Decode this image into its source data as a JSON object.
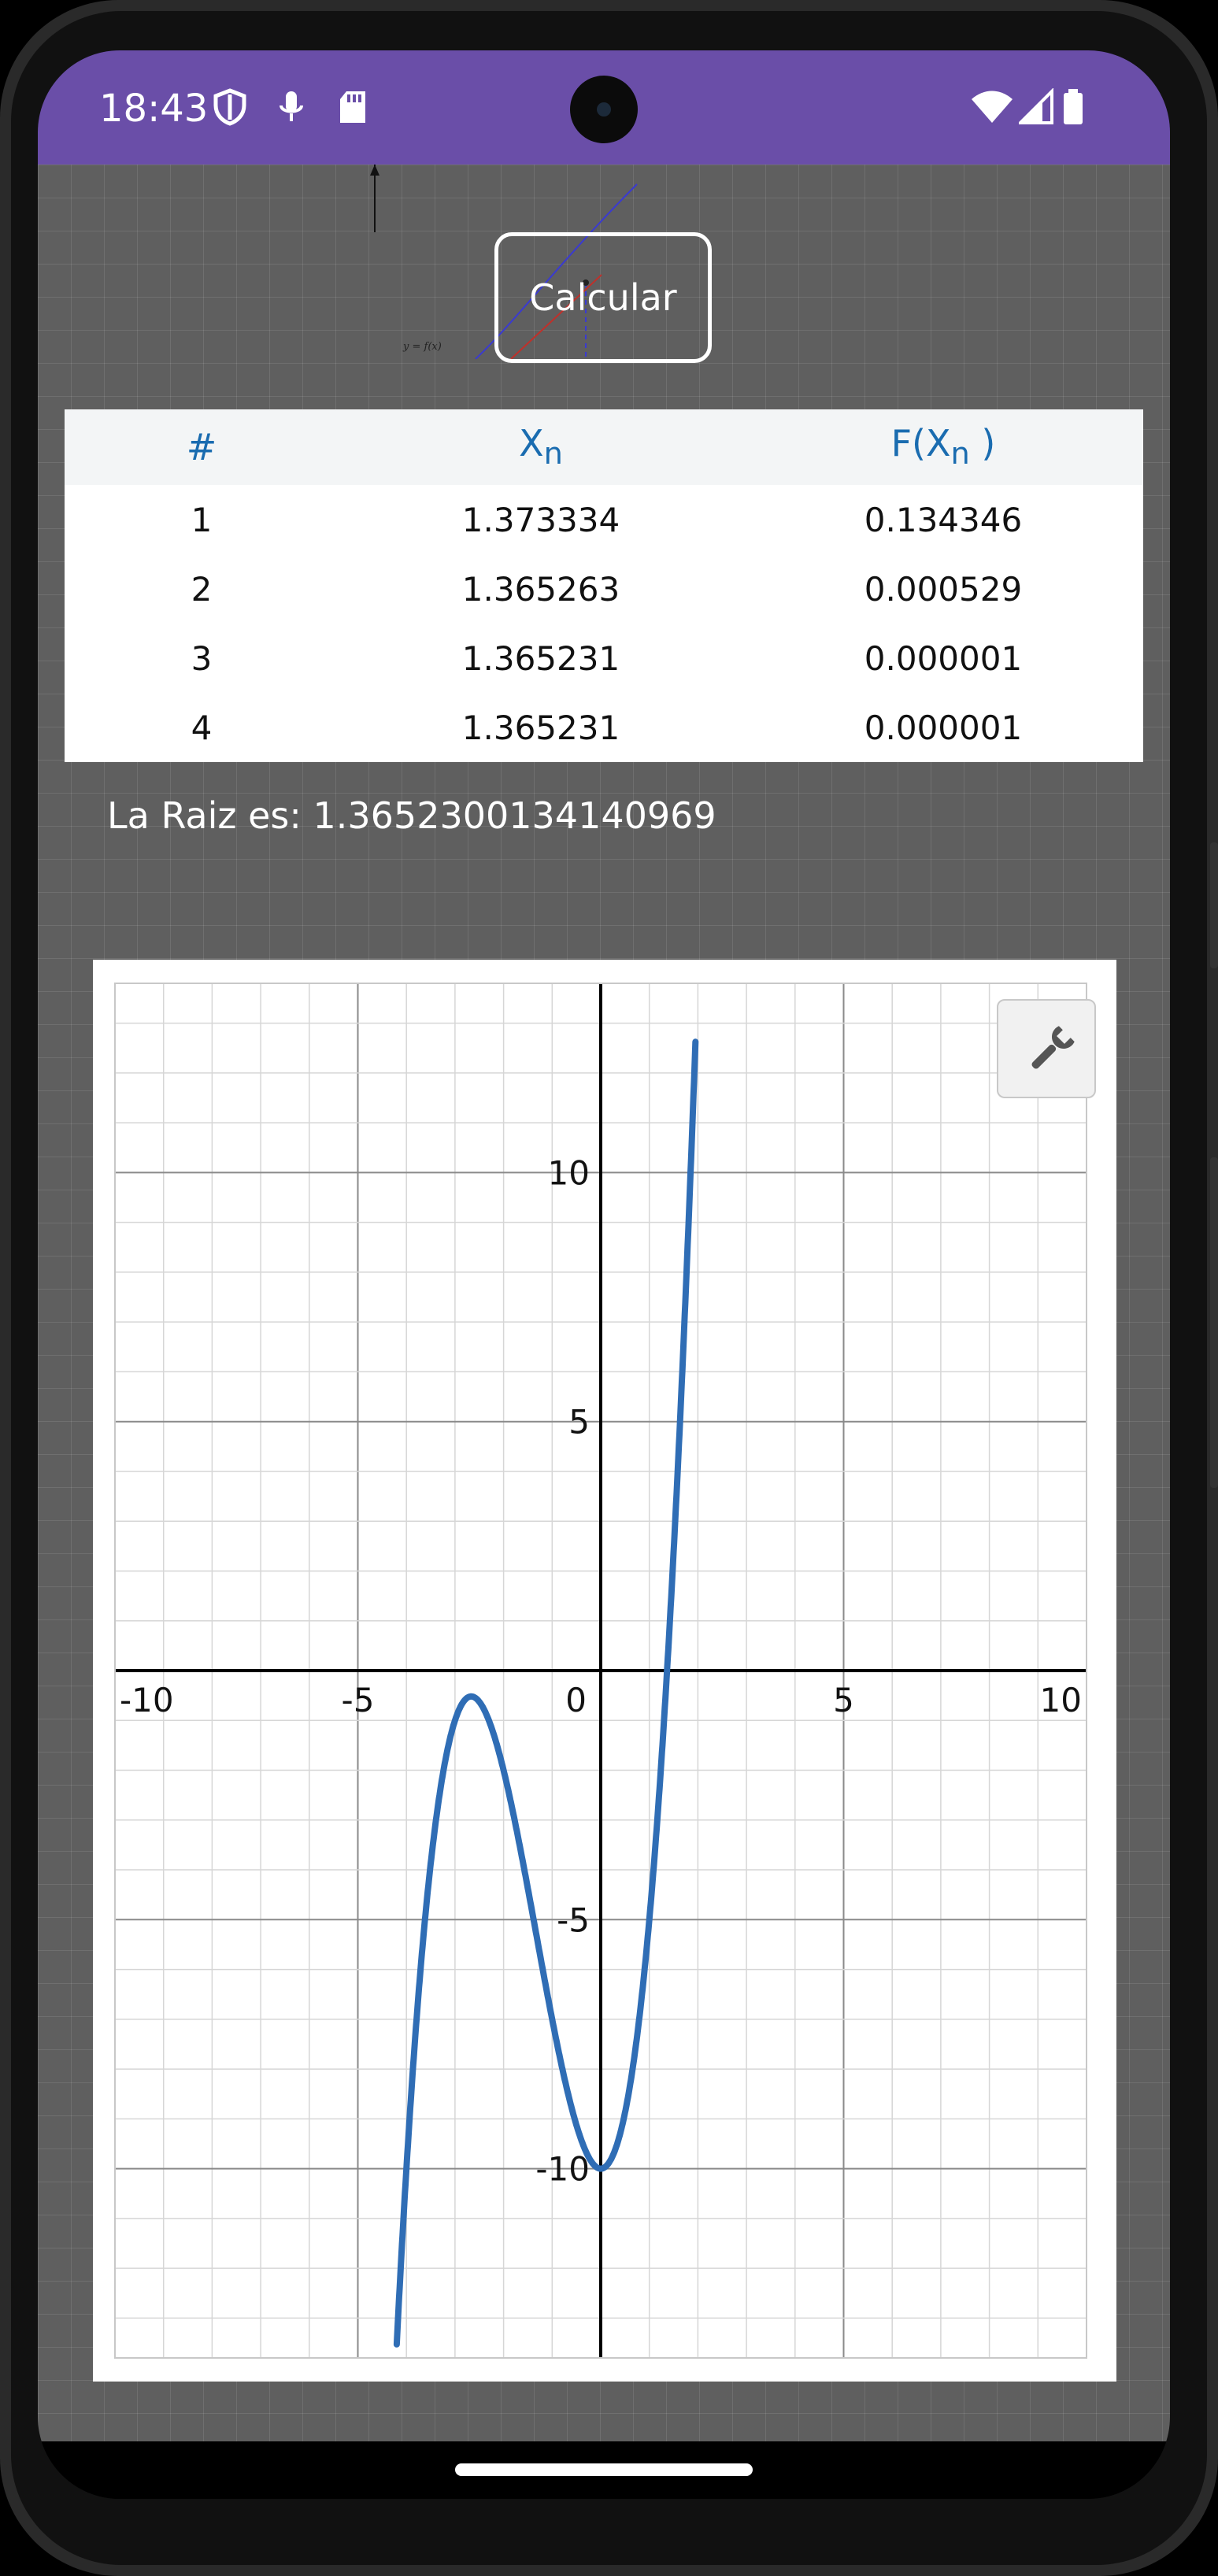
{
  "status_bar": {
    "time": "18:43",
    "left_icons": [
      "shield-icon",
      "mic-icon",
      "sd-card-icon"
    ],
    "right_icons": [
      "wifi-icon",
      "cell-signal-icon",
      "battery-icon"
    ],
    "color": "#6a4ea8"
  },
  "header": {
    "calculate_button": "Calcular",
    "illustration_label": "y = f(x)"
  },
  "table": {
    "headers": {
      "index": "#",
      "xn_main": "X",
      "xn_sub": "n",
      "fxn_main": "F(X",
      "fxn_sub": "n",
      "fxn_close": " )"
    },
    "rows": [
      {
        "n": "1",
        "xn": "1.373334",
        "fxn": "0.134346"
      },
      {
        "n": "2",
        "xn": "1.365263",
        "fxn": "0.000529"
      },
      {
        "n": "3",
        "xn": "1.365231",
        "fxn": "0.000001"
      },
      {
        "n": "4",
        "xn": "1.365231",
        "fxn": "0.000001"
      }
    ],
    "header_color": "#1a6cb0"
  },
  "result": {
    "root_text": "La Raiz es: 1.3652300134140969"
  },
  "graph": {
    "tools_icon": "wrench-icon",
    "curve_color": "#2f6db5"
  },
  "chart_data": {
    "type": "line",
    "function": "x^3 + 4x^2 - 10",
    "xlim": [
      -10,
      10
    ],
    "ylim": [
      -13.8,
      13.8
    ],
    "x_ticks": [
      "-10",
      "-5",
      "0",
      "5",
      "10"
    ],
    "y_ticks": [
      "10",
      "5",
      "-5",
      "-10"
    ],
    "grid": true,
    "series": [
      {
        "x": [
          -4.2,
          -4,
          -3.5,
          -3,
          -2.67,
          -2,
          -1.5,
          -1,
          -0.5,
          0,
          0.5,
          1,
          1.365,
          1.5,
          1.9,
          1.95
        ],
        "y": [
          -13.52,
          -10,
          -3.88,
          -1,
          -0.52,
          -2,
          -4.38,
          -7,
          -9.13,
          -10,
          -8.88,
          -5,
          0,
          2.38,
          11.3,
          12.62
        ]
      }
    ]
  }
}
